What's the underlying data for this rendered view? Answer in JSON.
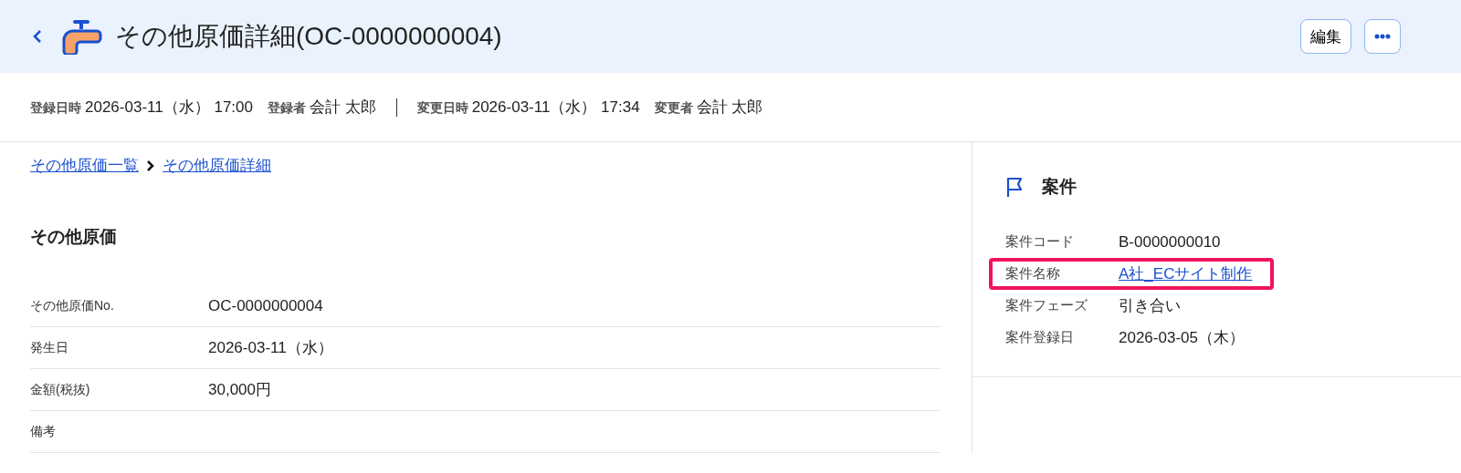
{
  "header": {
    "title": "その他原価詳細(OC-0000000004)",
    "buttons": [
      {
        "kind": "text",
        "label": "編集"
      },
      {
        "kind": "more"
      }
    ]
  },
  "meta": [
    {
      "label": "登録日時",
      "value": "2026-03-11（水） 17:00"
    },
    {
      "label": "登録者",
      "value": "会計 太郎"
    },
    {
      "label": "変更日時",
      "value": "2026-03-11（水） 17:34"
    },
    {
      "label": "変更者",
      "value": "会計 太郎"
    }
  ],
  "breadcrumb": [
    "その他原価一覧",
    "その他原価詳細"
  ],
  "section": {
    "title": "その他原価",
    "fields": [
      {
        "label": "その他原価No.",
        "value": "OC-0000000004"
      },
      {
        "label": "発生日",
        "value": "2026-03-11（水）"
      },
      {
        "label": "金額(税抜)",
        "value": "30,000円"
      },
      {
        "label": "備考"
      }
    ]
  },
  "side_panel": {
    "title": "案件",
    "fields": [
      {
        "label": "案件コード",
        "value": "B-0000000010",
        "kind": "text",
        "highlighted": false
      },
      {
        "label": "案件名称",
        "value": "A社_ECサイト制作",
        "kind": "link",
        "highlighted": true
      },
      {
        "label": "案件フェーズ",
        "value": "引き合い",
        "kind": "text",
        "highlighted": false
      },
      {
        "label": "案件登録日",
        "value": "2026-03-05（木）",
        "kind": "text",
        "highlighted": false
      }
    ]
  }
}
